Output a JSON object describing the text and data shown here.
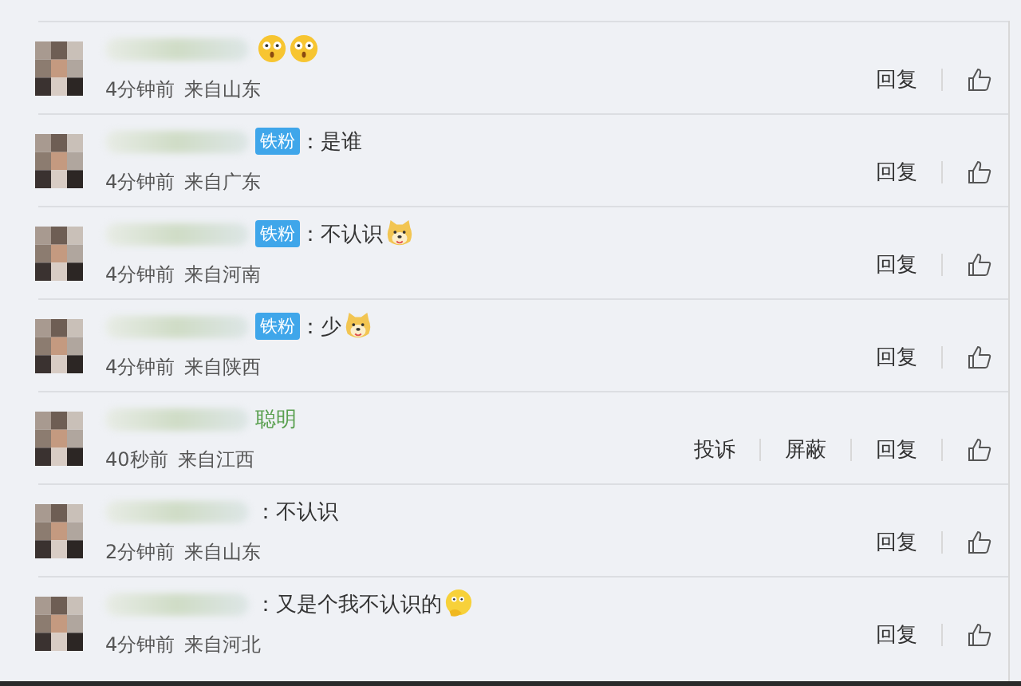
{
  "comments": [
    {
      "emojis": [
        {
          "kind": "shocked"
        },
        {
          "kind": "shocked"
        }
      ],
      "time": "4分钟前",
      "location": "来自山东",
      "actions": [
        "回复"
      ]
    },
    {
      "badge": "铁粉",
      "text": "：是谁",
      "time": "4分钟前",
      "location": "来自广东",
      "actions": [
        "回复"
      ]
    },
    {
      "badge": "铁粉",
      "text": "：不认识",
      "emojis": [
        {
          "kind": "doge"
        }
      ],
      "time": "4分钟前",
      "location": "来自河南",
      "actions": [
        "回复"
      ]
    },
    {
      "badge": "铁粉",
      "text": "：少",
      "emojis": [
        {
          "kind": "doge"
        }
      ],
      "time": "4分钟前",
      "location": "来自陕西",
      "actions": [
        "回复"
      ]
    },
    {
      "name_fragment": "聪明",
      "time": "40秒前",
      "location": "来自江西",
      "actions": [
        "投诉",
        "屏蔽",
        "回复"
      ]
    },
    {
      "text": "：不认识",
      "time": "2分钟前",
      "location": "来自山东",
      "actions": [
        "回复"
      ]
    },
    {
      "text": "：又是个我不认识的",
      "emojis": [
        {
          "kind": "thinking"
        }
      ],
      "time": "4分钟前",
      "location": "来自河北",
      "actions": [
        "回复"
      ]
    }
  ]
}
